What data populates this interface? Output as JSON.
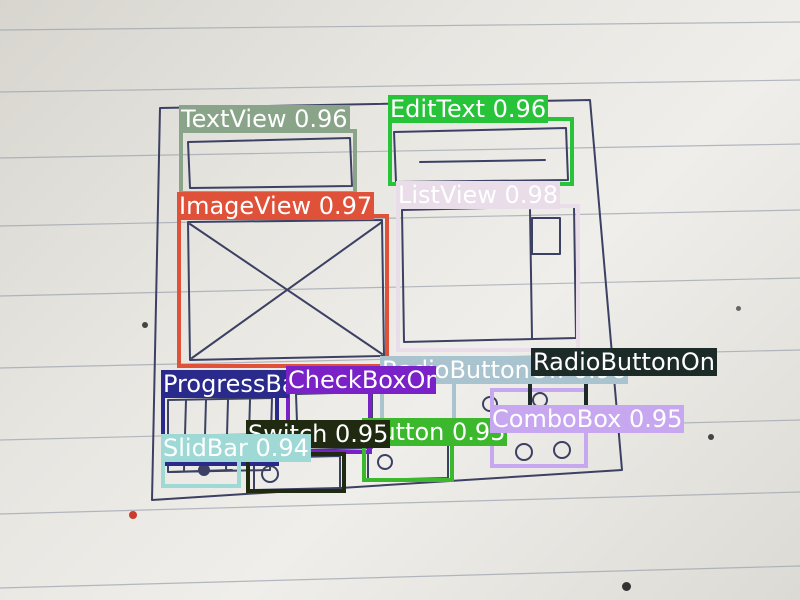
{
  "detections": [
    {
      "label": "TextView",
      "score": "0.96",
      "color": "#8aa48a",
      "text_color": "#ffffff"
    },
    {
      "label": "EditText",
      "score": "0.96",
      "color": "#27c43a",
      "text_color": "#ffffff"
    },
    {
      "label": "ListView",
      "score": "0.98",
      "color": "#e8dde8",
      "text_color": "#ffffff"
    },
    {
      "label": "ImageView",
      "score": "0.97",
      "color": "#e0513a",
      "text_color": "#ffffff"
    },
    {
      "label": "ProgressBar",
      "score": "",
      "color": "#2a2a8c",
      "text_color": "#ffffff"
    },
    {
      "label": "CheckBoxOn",
      "score": "",
      "color": "#7a22c8",
      "text_color": "#ffffff"
    },
    {
      "label": "RadioButtonOff",
      "score": "0.96",
      "color": "#a9c4cf",
      "text_color": "#ffffff"
    },
    {
      "label": "RadioButtonOn",
      "score": "",
      "color": "#1d2b28",
      "text_color": "#ffffff"
    },
    {
      "label": "Button",
      "score": "0.95",
      "color": "#3bb82c",
      "text_color": "#ffffff"
    },
    {
      "label": "Switch",
      "score": "0.95",
      "color": "#202a10",
      "text_color": "#ffffff"
    },
    {
      "label": "ComboBox",
      "score": "0.95",
      "color": "#c7a8f0",
      "text_color": "#ffffff"
    },
    {
      "label": "SlidBar",
      "score": "0.94",
      "color": "#9fd9d6",
      "text_color": "#ffffff"
    }
  ]
}
